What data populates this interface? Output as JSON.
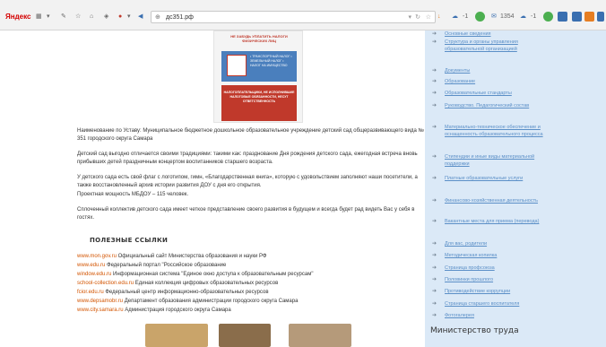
{
  "browser": {
    "logo": "Яндекс",
    "address": "дс351.рф",
    "mail_count": "1354",
    "badge_a": "-1",
    "badge_b": "-1"
  },
  "poster": {
    "header": "НЕ ЗАБУДЬ УПЛАТИТЬ НАЛОГИ ФИЗИЧЕСКИХ ЛИЦ",
    "items": "• ТРАНСПОРТНЫЙ НАЛОГ • ЗЕМЕЛЬНЫЙ НАЛОГ • НАЛОГ НА ИМУЩЕСТВО",
    "footer": "НАЛОГОПЛАТЕЛЬЩИКИ, НЕ ИСПОЛНИВШИЕ НАЛОГОВЫЕ ОБЯЗАННОСТИ, НЕСУТ ОТВЕТСТВЕННОСТЬ"
  },
  "content": {
    "p1": "Наименование по Уставу: Муниципальное бюджетное дошкольное образовательное учреждение детский сад общеразвивающего вида № 351 городского округа Самара",
    "p2": "Детский сад выгодно отличается своими традициями: такими как: празднование Дня рождения детского сада, ежегодная встреча вновь прибывших детей праздничным концертом воспитанников старшего возраста.",
    "p3": "У детского сада есть свой флаг с логотипом, гимн, «Благодарственная книга», которую с удовольствием заполняют наши посетители, а также восстановленный архив истории развития ДОУ с дня его открытия.",
    "p4": "Проектная мощность МБДОУ – 115 человек.",
    "p5": "Сплоченный коллектив детского сада имеет четкое представление своего развития в будущем и всегда будет рад видеть Вас у себя в гостях."
  },
  "useful_links": {
    "title": "ПОЛЕЗНЫЕ ССЫЛКИ",
    "items": [
      {
        "url": "www.mon.gov.ru",
        "desc": "Официальный сайт Министерства образования и науки РФ"
      },
      {
        "url": "www.edu.ru",
        "desc": "Федеральный портал \"Российское образование"
      },
      {
        "url": "window.edu.ru",
        "desc": "Информационная система \"Единое окно доступа к образовательным ресурсам\""
      },
      {
        "url": "school-collection.edu.ru",
        "desc": "Единая коллекция цифровых образовательных ресурсов"
      },
      {
        "url": "fcior.edu.ru",
        "desc": "Федеральный центр информационно-образовательных ресурсов"
      },
      {
        "url": "www.depsamobr.ru",
        "desc": "Департамент образования администрации городского округа Самара"
      },
      {
        "url": "www.city.samara.ru",
        "desc": "Администрация городского округа Самара"
      }
    ]
  },
  "sidebar": {
    "items": [
      "Основные сведения",
      "Структура и органы управления образовательной организацией",
      "Документы",
      "Образование",
      "Образовательные стандарты",
      "Руководство. Педагогический состав",
      "Материально-техническое обеспечение и оснащенность образовательного процесса",
      "Стипендии и иные виды материальной поддержки",
      "Платные образовательные услуги",
      "Финансово-хозяйственная деятельность",
      "Вакантные места для приема (перевода)",
      "Для вас, родители",
      "Методическая копилка",
      "Страница профсоюза",
      "Половинки прошлого",
      "Противодействие коррупции",
      "Страница старшего воспитателя",
      "Фотогалерея"
    ],
    "section_title": "Министерство труда"
  },
  "colors": {
    "sidebar_bg": "#dbe9f7",
    "link_orange": "#d35400",
    "nav_link": "#5b8fc7"
  }
}
